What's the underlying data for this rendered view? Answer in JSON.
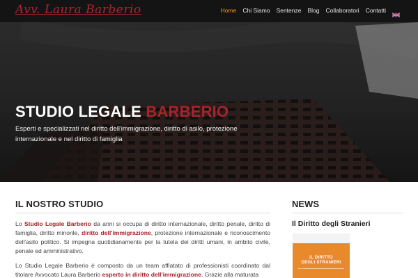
{
  "header": {
    "logo": "Avv. Laura Barberio",
    "nav": [
      {
        "label": "Home",
        "active": true
      },
      {
        "label": "Chi Siamo",
        "active": false
      },
      {
        "label": "Sentenze",
        "active": false
      },
      {
        "label": "Blog",
        "active": false
      },
      {
        "label": "Collaboratori",
        "active": false
      },
      {
        "label": "Contatti",
        "active": false
      }
    ],
    "language_icon": "uk-flag-icon"
  },
  "hero": {
    "title_main": "STUDIO LEGALE",
    "title_accent": "BARBERIO",
    "subtitle": "Esperti e specializzati nel diritto dell'immigrazione, diritto di asilo, protezione internazionale e nel diritto di famiglia"
  },
  "main": {
    "section_title": "IL NOSTRO STUDIO",
    "p1": {
      "t1": "Lo ",
      "h1": "Studio Legale Barberio",
      "t2": " da anni si occupa di diritto internazionale, diritto penale, diritto di famiglia, diritto minorile, ",
      "h2": "diritto dell'immigrazione",
      "t3": ", protezione internazionale e riconoscimento dell'asilo politico. Si impegna quotidianamente per la tutela dei diritti umani, in ambito civile, penale ed amministrativo."
    },
    "p2": {
      "t1": "Lo Studio Legale Barberio è composto da un team affiatato di professionisti coordinato dal titolare Avvocato Laura Barberio ",
      "h1": "esperto in diritto dell'immigrazione",
      "t2": ". Grazie alla maturata"
    }
  },
  "news": {
    "section_title": "NEWS",
    "item_title": "Il Diritto degli Stranieri",
    "book": {
      "title_line1": "IL DIRITTO",
      "title_line2": "DEGLI STRANIERI"
    }
  },
  "colors": {
    "accent_red": "#a8232a",
    "nav_active": "#f29321",
    "header_bg": "#141414"
  }
}
